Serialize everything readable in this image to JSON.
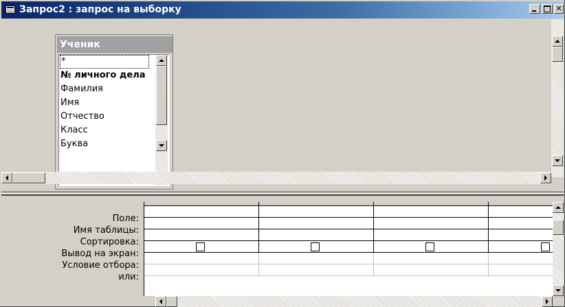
{
  "window": {
    "title": "Запрос2 : запрос на выборку",
    "controls": {
      "minimize": "_",
      "maximize": "□",
      "close": "✕"
    },
    "icons": [
      "query-window-icon",
      "minimize-icon",
      "maximize-icon",
      "close-icon"
    ]
  },
  "field_list": {
    "table_name": "Ученик",
    "items": [
      {
        "label": "*",
        "bold": false,
        "selected": true
      },
      {
        "label": "№ личного дела",
        "bold": true,
        "selected": false
      },
      {
        "label": "Фамилия",
        "bold": false,
        "selected": false
      },
      {
        "label": "Имя",
        "bold": false,
        "selected": false
      },
      {
        "label": "Отчество",
        "bold": false,
        "selected": false
      },
      {
        "label": "Класс",
        "bold": false,
        "selected": false
      },
      {
        "label": "Буква",
        "bold": false,
        "selected": false
      }
    ]
  },
  "design_grid": {
    "row_labels": {
      "field": "Поле:",
      "table": "Имя таблицы:",
      "sort": "Сортировка:",
      "show": "Вывод на экран:",
      "criteria": "Условие отбора:",
      "or": "или:"
    },
    "columns": [
      {
        "field": "",
        "table": "",
        "sort": "",
        "show": false,
        "criteria": "",
        "or": ""
      },
      {
        "field": "",
        "table": "",
        "sort": "",
        "show": false,
        "criteria": "",
        "or": ""
      },
      {
        "field": "",
        "table": "",
        "sort": "",
        "show": false,
        "criteria": "",
        "or": ""
      },
      {
        "field": "",
        "table": "",
        "sort": "",
        "show": false,
        "criteria": "",
        "or": ""
      }
    ]
  },
  "colors": {
    "titlebar_start": "#0a246a",
    "titlebar_end": "#a6caf0",
    "face": "#d4d0c8",
    "field_list_title": "#a0a0a0"
  }
}
